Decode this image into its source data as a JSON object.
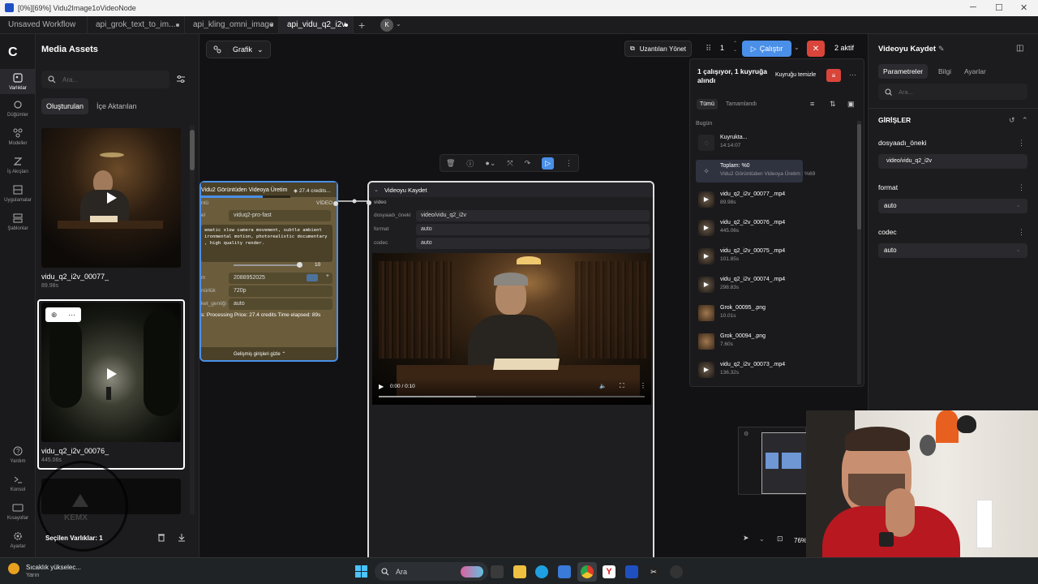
{
  "window": {
    "title": "[0%][69%] Vidu2Image1oVideoNode"
  },
  "tabs": [
    {
      "label": "Unsaved Workflow"
    },
    {
      "label": "api_grok_text_to_im..."
    },
    {
      "label": "api_kling_omni_image"
    },
    {
      "label": "api_vidu_q2_i2v"
    }
  ],
  "avatar_letter": "K",
  "rail": [
    {
      "label": "Varlıklar",
      "icon": "assets-icon"
    },
    {
      "label": "Düğümler",
      "icon": "nodes-icon"
    },
    {
      "label": "Modeller",
      "icon": "models-icon"
    },
    {
      "label": "İş Akışları",
      "icon": "workflows-icon"
    },
    {
      "label": "Uygulamalar",
      "icon": "apps-icon"
    },
    {
      "label": "Şablonlar",
      "icon": "templates-icon"
    },
    {
      "label": "Yardım",
      "icon": "help-icon"
    },
    {
      "label": "Konsol",
      "icon": "console-icon"
    },
    {
      "label": "Kısayollar",
      "icon": "keyboard-icon"
    },
    {
      "label": "Ayarlar",
      "icon": "settings-icon"
    }
  ],
  "assets": {
    "title": "Media Assets",
    "search_placeholder": "Ara...",
    "tab_generated": "Oluşturulan",
    "tab_imported": "İçe Aktarılan",
    "items": [
      {
        "name": "vidu_q2_i2v_00077_",
        "duration": "89.98s"
      },
      {
        "name": "vidu_q2_i2v_00076_",
        "duration": "445.06s"
      }
    ],
    "selected_label": "Seçilen Varlıklar: 1",
    "watermark": "KEMX"
  },
  "toolbar": {
    "graph_label": "Grafik",
    "extensions_label": "Uzantıları Yönet",
    "batch_count": "1",
    "run_label": "Çalıştır",
    "active_label": "2 aktif"
  },
  "queue": {
    "status": "1 çalışıyor, 1 kuyruğa alındı",
    "clear_label": "Kuyruğu temizle",
    "filter_all": "Tümü",
    "filter_done": "Tamamlandı",
    "section": "Bugün",
    "pending": {
      "name": "Kuyrukta...",
      "time": "14:14:07"
    },
    "running": {
      "name": "Toplam: %0",
      "sub": "Vidu2 Görüntüden Videoya Üretim : %69"
    },
    "items": [
      {
        "name": "vidu_q2_i2v_00077_.mp4",
        "dur": "89.98s",
        "kind": "video"
      },
      {
        "name": "vidu_q2_i2v_00076_.mp4",
        "dur": "445.06s",
        "kind": "video"
      },
      {
        "name": "vidu_q2_i2v_00075_.mp4",
        "dur": "101.85s",
        "kind": "video"
      },
      {
        "name": "vidu_q2_i2v_00074_.mp4",
        "dur": "298.83s",
        "kind": "video"
      },
      {
        "name": "Grok_00095_.png",
        "dur": "10.01s",
        "kind": "image"
      },
      {
        "name": "Grok_00094_.png",
        "dur": "7.60s",
        "kind": "image"
      },
      {
        "name": "vidu_q2_i2v_00073_.mp4",
        "dur": "136.32s",
        "kind": "video"
      }
    ]
  },
  "vidu_node": {
    "title": "Vidu2 Görüntüden Videoya Üretim",
    "credits": "27.4 credits...",
    "progress": 0.69,
    "label_model": "el",
    "model": "viduq2-pro-fast",
    "output_label": "VİDEO",
    "input_label": "ntü",
    "prompt": "ematic slow camera movement, subtle ambient\nironmental motion, photorealistic documentary\n, high quality render.",
    "duration_value": "10",
    "label_seed": "m",
    "seed": "2088952025",
    "label_resolution": "nürlük",
    "resolution": "720p",
    "label_movement": "ket_genliği",
    "movement": "auto",
    "status": "s: Processing Price: 27.4 credits Time elapsed: 89s",
    "advanced_label": "Gelişmiş girişleri gizle"
  },
  "save_node": {
    "title": "Videoyu Kaydet",
    "input_label": "video",
    "labels": {
      "prefix": "dosyaadı_öneki",
      "format": "format",
      "codec": "codec"
    },
    "prefix": "video/vidu_q2_i2v",
    "format": "auto",
    "codec": "auto",
    "video_time": "0:00 / 0:10",
    "video_progress": 0.0
  },
  "zoom_label": "76%",
  "right_panel": {
    "title": "Videoyu Kaydet",
    "tab_params": "Parametreler",
    "tab_info": "Bilgi",
    "tab_settings": "Ayarlar",
    "search_placeholder": "Ara...",
    "section": "GİRİŞLER",
    "fields": [
      {
        "label": "dosyaadı_öneki",
        "value": "video/vidu_q2_i2v"
      },
      {
        "label": "format",
        "value": "auto"
      },
      {
        "label": "codec",
        "value": "auto"
      }
    ]
  },
  "taskbar": {
    "weather": "Sıcaklık yükselec...",
    "weather_sub": "Yarın",
    "search_label": "Ara"
  },
  "colors": {
    "accent": "#4a8fe8",
    "danger": "#d9453a",
    "node_selected": "#4a8fe8"
  }
}
